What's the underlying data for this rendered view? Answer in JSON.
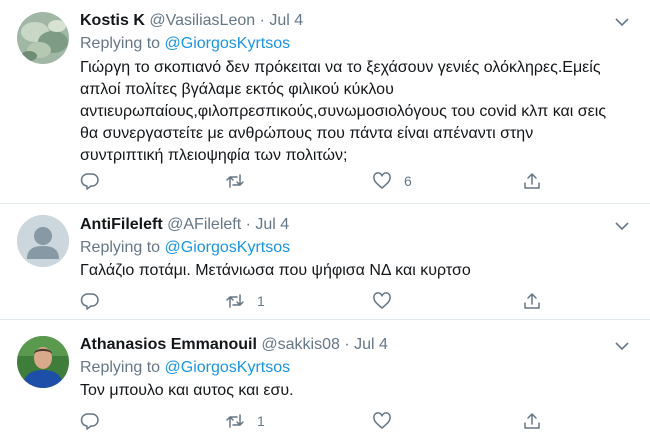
{
  "colors": {
    "accent": "#1b95e0",
    "muted": "#657786",
    "divider": "#e1e8ed"
  },
  "icons": [
    "chevron-down-icon",
    "reply-icon",
    "retweet-icon",
    "like-icon",
    "share-icon",
    "default-avatar-icon"
  ],
  "reply_prefix": "Replying to",
  "tweets": [
    {
      "name": "Kostis K",
      "handle": "@VasiliasLeon",
      "sep": "·",
      "date": "Jul 4",
      "reply_to": "@GiorgosKyrtsos",
      "lines": [
        "Γιώργη το σκοπιανό δεν πρόκειται να το ξεχάσουν γενιές ολόκληρες.Εμείς",
        "απλοί πολίτες βγάλαμε εκτός φιλικού κύκλου",
        "αντιευρωπαίους,φιλοπρεσπικούς,συνωμοσιολόγους του covid κλπ και σεις",
        "θα συνεργαστείτε με ανθρώπους που πάντα είναι απέναντι στην",
        "συντριπτική πλειοψηφία των πολιτών;"
      ],
      "replies": "",
      "retweets": "",
      "likes": "6"
    },
    {
      "name": "AntiFileleft",
      "handle": "@AFileleft",
      "sep": "·",
      "date": "Jul 4",
      "reply_to": "@GiorgosKyrtsos",
      "lines": [
        "Γαλάζιο ποτάμι. Μετάνιωσα που ψήφισα ΝΔ και κυρτσο"
      ],
      "replies": "",
      "retweets": "1",
      "likes": ""
    },
    {
      "name": "Athanasios Emmanouil",
      "handle": "@sakkis08",
      "sep": "·",
      "date": "Jul 4",
      "reply_to": "@GiorgosKyrtsos",
      "lines": [
        "Τον μπουλο και αυτος και εσυ."
      ],
      "replies": "",
      "retweets": "1",
      "likes": ""
    }
  ]
}
